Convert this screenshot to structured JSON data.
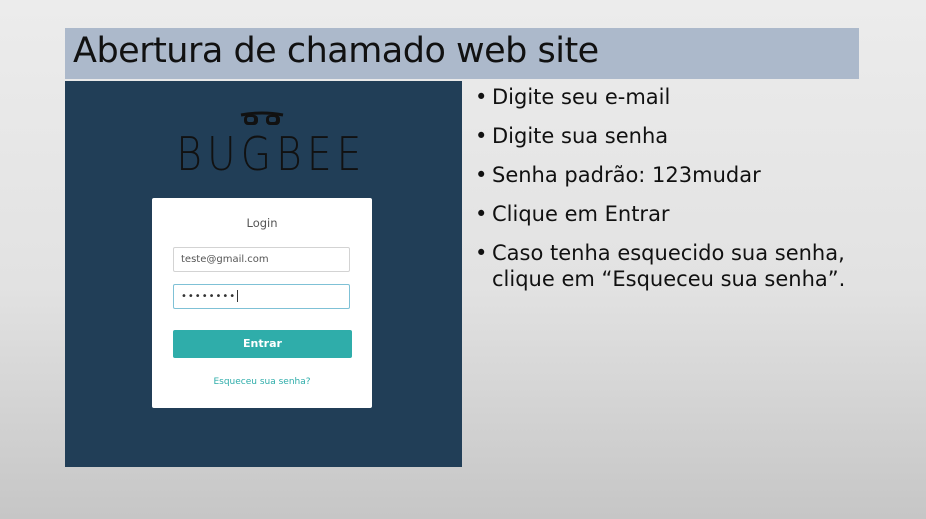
{
  "slide": {
    "title": "Abertura de chamado web site"
  },
  "screenshot": {
    "logo_text": "BUGBEE",
    "login": {
      "title": "Login",
      "email_value": "teste@gmail.com",
      "password_mask": "••••••••",
      "submit_label": "Entrar",
      "forgot_link": "Esqueceu sua senha?"
    }
  },
  "bullets": {
    "symbol": "•",
    "items": [
      {
        "line1": "Digite seu e-mail"
      },
      {
        "line1": "Digite sua senha"
      },
      {
        "line1": "Senha padrão: 123mudar"
      },
      {
        "line1": "Clique em Entrar"
      },
      {
        "line1": "Caso tenha esquecido sua senha,",
        "line2": "clique em “Esqueceu sua senha”."
      }
    ]
  },
  "colors": {
    "title_bar": "#acb9cb",
    "screenshot_bg": "#213e57",
    "accent": "#2fadaa"
  }
}
